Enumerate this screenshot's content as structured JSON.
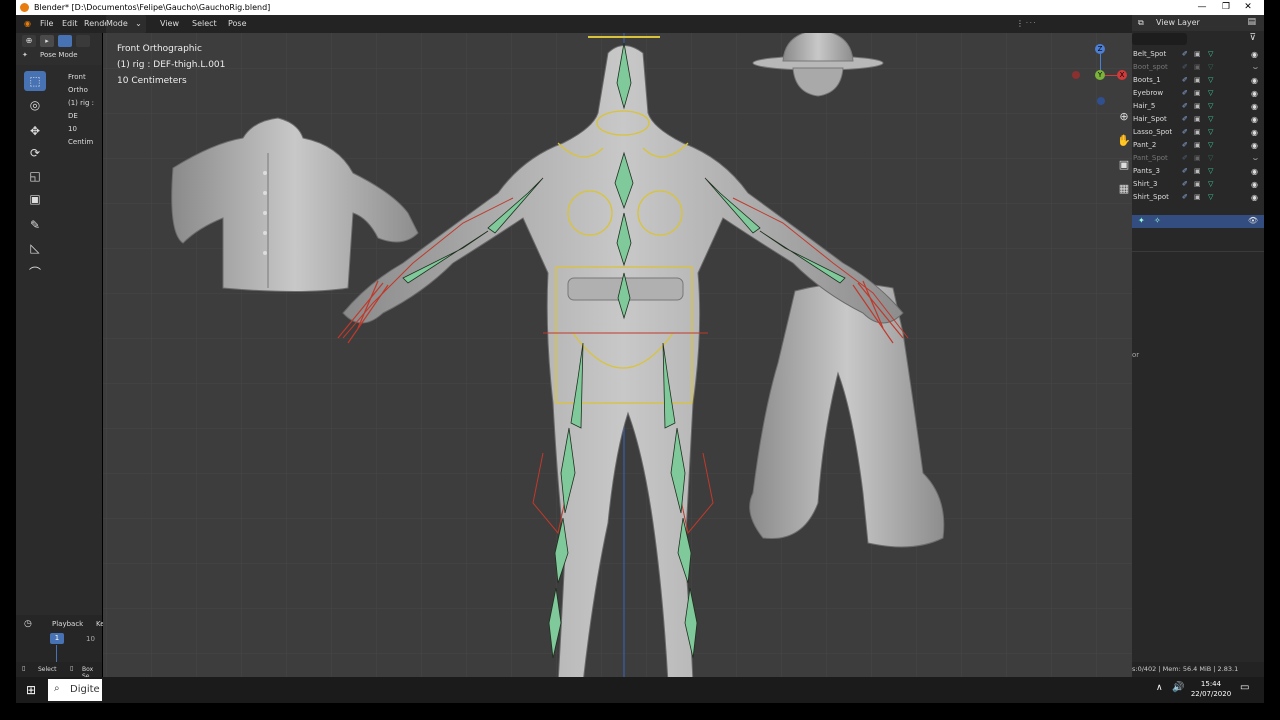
{
  "window": {
    "title": "Blender* [D:\\Documentos\\Felipe\\Gaucho\\GauchoRig.blend]",
    "min": "—",
    "restore": "❐",
    "close": "✕"
  },
  "menubar": {
    "file": "File",
    "edit": "Edit",
    "render": "Rende",
    "mode": "Mode",
    "view": "View",
    "select": "Select",
    "pose": "Pose"
  },
  "header": {
    "pose_mode": "Pose Mode",
    "view_layer": "View Layer"
  },
  "mini_viewport": {
    "view_name": "Front Ortho",
    "rig": "(1) rig : DE",
    "scale": "10 Centim"
  },
  "viewport": {
    "view_name": "Front Orthographic",
    "active": "(1) rig : DEF-thigh.L.001",
    "scale": "10 Centimeters"
  },
  "gizmo": {
    "z": "Z",
    "y": "Y",
    "x": "X"
  },
  "outliner": {
    "items": [
      {
        "name": "Belt_Spot",
        "dim": false,
        "hidden": false
      },
      {
        "name": "Boot_spot",
        "dim": true,
        "hidden": true
      },
      {
        "name": "Boots_1",
        "dim": false,
        "hidden": false
      },
      {
        "name": "Eyebrow",
        "dim": false,
        "hidden": false
      },
      {
        "name": "Hair_5",
        "dim": false,
        "hidden": false
      },
      {
        "name": "Hair_Spot",
        "dim": false,
        "hidden": false
      },
      {
        "name": "Lasso_Spot",
        "dim": false,
        "hidden": false
      },
      {
        "name": "Pant_2",
        "dim": false,
        "hidden": false
      },
      {
        "name": "Pant_Spot",
        "dim": true,
        "hidden": true
      },
      {
        "name": "Pants_3",
        "dim": false,
        "hidden": false
      },
      {
        "name": "Shirt_3",
        "dim": false,
        "hidden": false
      },
      {
        "name": "Shirt_Spot",
        "dim": false,
        "hidden": false
      }
    ],
    "side_label": "or"
  },
  "timeline": {
    "playback": "Playback",
    "keying": "Ke",
    "current_frame": "1",
    "frame_10": "10"
  },
  "statusbar": {
    "select": "Select",
    "box_select": "Box Se",
    "stats": "s:0/402 | Mem: 56.4 MiB | 2.83.1"
  },
  "taskbar": {
    "search": "Digite",
    "time": "15:44",
    "date": "22/07/2020"
  },
  "colors": {
    "accent": "#4772b3",
    "bone_green": "#7fc99a",
    "bone_outline": "#1f1f1f",
    "select_yellow": "#d9c33a",
    "ik_red": "#c0392b"
  }
}
